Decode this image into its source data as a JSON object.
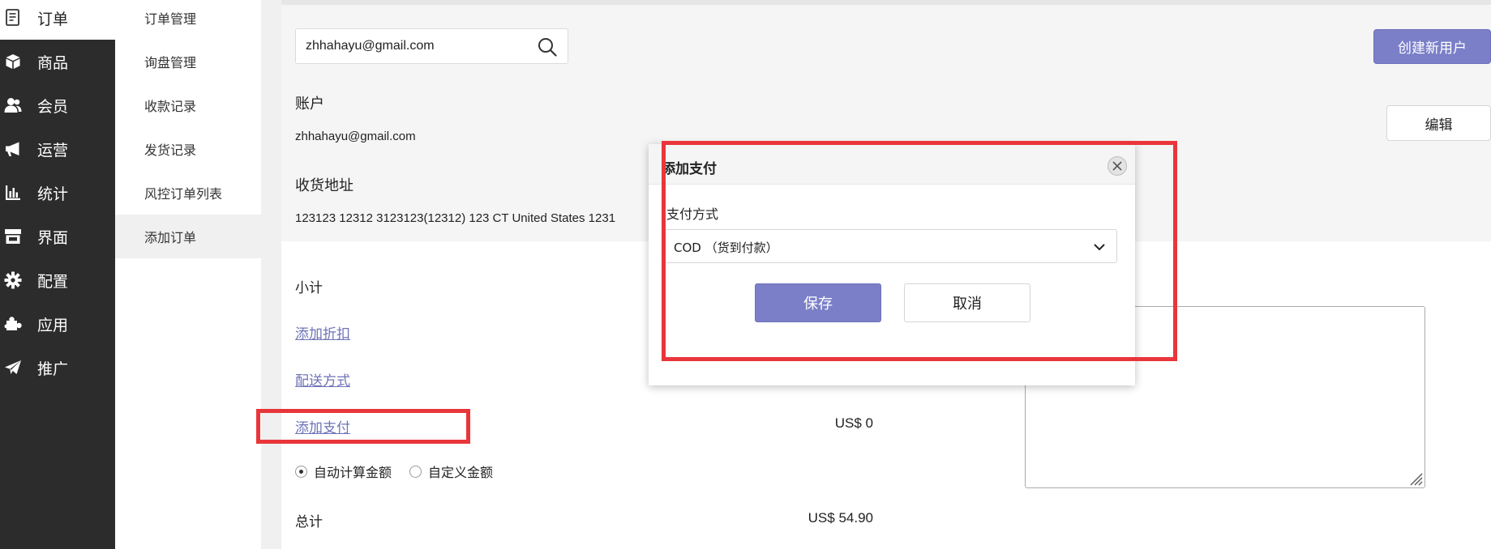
{
  "nav": {
    "items": [
      {
        "label": "订单",
        "icon": "order-icon"
      },
      {
        "label": "商品",
        "icon": "box-icon"
      },
      {
        "label": "会员",
        "icon": "user-icon"
      },
      {
        "label": "运营",
        "icon": "megaphone-icon"
      },
      {
        "label": "统计",
        "icon": "bar-chart-icon"
      },
      {
        "label": "界面",
        "icon": "storefront-icon"
      },
      {
        "label": "配置",
        "icon": "gear-icon"
      },
      {
        "label": "应用",
        "icon": "puzzle-icon"
      },
      {
        "label": "推广",
        "icon": "paper-plane-icon"
      }
    ]
  },
  "subnav": {
    "items": [
      {
        "label": "订单管理"
      },
      {
        "label": "询盘管理"
      },
      {
        "label": "收款记录"
      },
      {
        "label": "发货记录"
      },
      {
        "label": "风控订单列表"
      },
      {
        "label": "添加订单"
      }
    ],
    "active": "添加订单"
  },
  "customer": {
    "search_value": "zhhahayu@gmail.com",
    "create_user_label": "创建新用户",
    "edit_label": "编辑",
    "account_label": "账户",
    "account_value": "zhhahayu@gmail.com",
    "address_label": "收货地址",
    "address_value": "123123 12312 3123123(12312) 123 CT United States 1231"
  },
  "order": {
    "subtotal_label": "小计",
    "add_discount_link": "添加折扣",
    "shipping_link": "配送方式",
    "add_payment_link": "添加支付",
    "payment_amount": "US$ 0",
    "radio_auto_label": "自动计算金额",
    "radio_custom_label": "自定义金额",
    "total_label": "总计",
    "total_amount": "US$ 54.90"
  },
  "modal": {
    "title": "添加支付",
    "method_label": "支付方式",
    "method_value": "COD （货到付款）",
    "save_label": "保存",
    "cancel_label": "取消"
  },
  "colors": {
    "accent": "#7b7fc8",
    "highlight": "#e8363a",
    "nav_bg": "#2c2c2c"
  }
}
